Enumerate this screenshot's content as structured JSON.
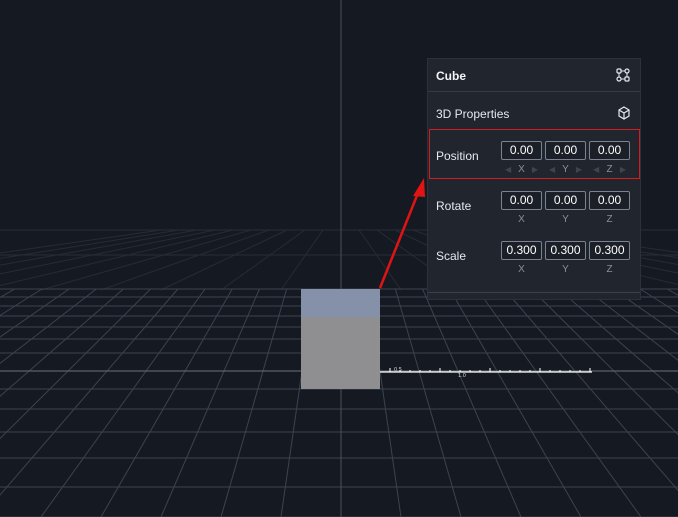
{
  "scene": {
    "object": "cube",
    "ruler_labels": [
      "0.5",
      "1.0"
    ]
  },
  "panel": {
    "title": "Cube",
    "header_icon": "link-nodes-icon",
    "section_title": "3D Properties",
    "section_icon": "3d-axes-icon",
    "position": {
      "label": "Position",
      "x": "0.00",
      "y": "0.00",
      "z": "0.00"
    },
    "rotate": {
      "label": "Rotate",
      "x": "0.00",
      "y": "0.00",
      "z": "0.00"
    },
    "scale": {
      "label": "Scale",
      "x": "0.300",
      "y": "0.300",
      "z": "0.300"
    },
    "axes": {
      "x": "X",
      "y": "Y",
      "z": "Z"
    }
  },
  "colors": {
    "background": "#151a22",
    "grid": "#3d434d",
    "panel": "#20252e",
    "cube_top": "#8591a8",
    "cube_front": "#8f8f91",
    "highlight": "#d11d1d",
    "arrow": "#e01414"
  }
}
